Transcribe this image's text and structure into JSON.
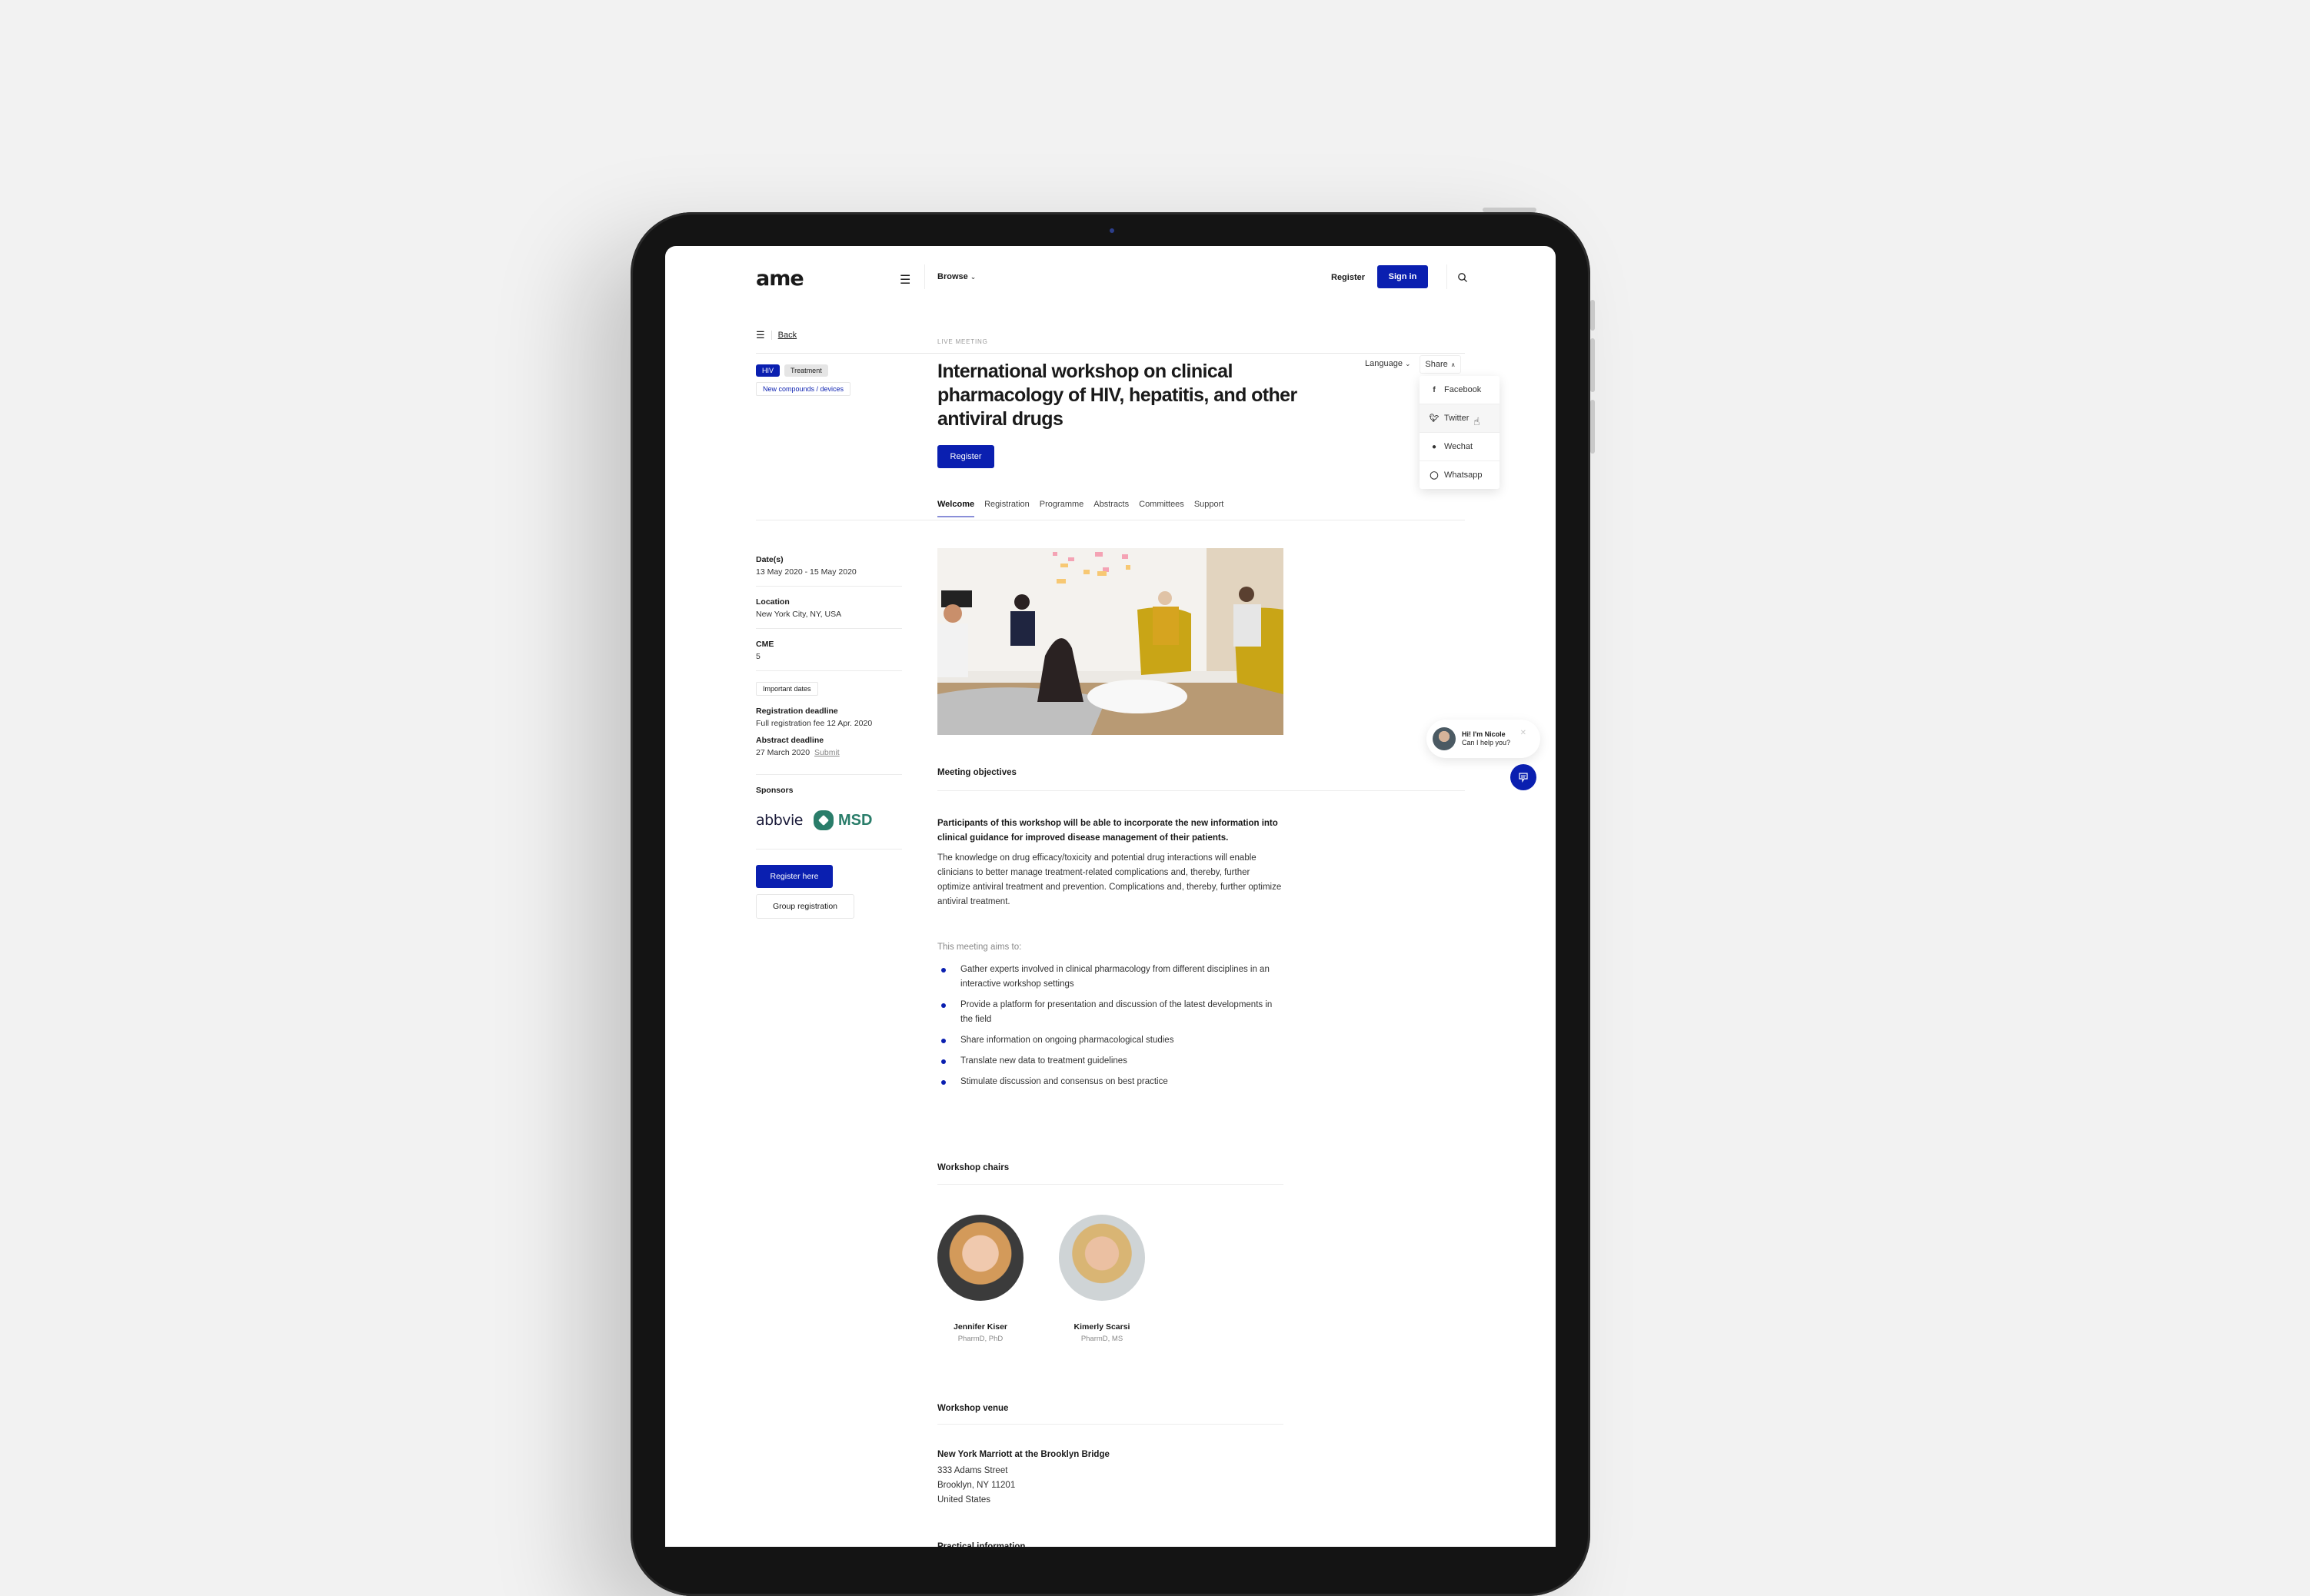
{
  "header": {
    "logo": "ame",
    "browse_label": "Browse",
    "register_label": "Register",
    "signin_label": "Sign in"
  },
  "back_label": "Back",
  "event": {
    "type_label": "LIVE MEETING",
    "title": "International workshop on clinical pharmacology of HIV, hepatitis, and other antiviral drugs",
    "register_label": "Register",
    "tags": [
      "HIV",
      "Treatment",
      "New compounds / devices"
    ]
  },
  "controls": {
    "language_label": "Language",
    "share_label": "Share",
    "share_menu": [
      {
        "label": "Facebook",
        "icon": "facebook-icon"
      },
      {
        "label": "Twitter",
        "icon": "twitter-icon"
      },
      {
        "label": "Wechat",
        "icon": "wechat-icon"
      },
      {
        "label": "Whatsapp",
        "icon": "whatsapp-icon"
      }
    ]
  },
  "tabs": [
    "Welcome",
    "Registration",
    "Programme",
    "Abstracts",
    "Committees",
    "Support"
  ],
  "active_tab": "Welcome",
  "sidebar": {
    "dates_label": "Date(s)",
    "dates_value": "13 May 2020 - 15 May 2020",
    "location_label": "Location",
    "location_value": "New York City, NY, USA",
    "cme_label": "CME",
    "cme_value": "5",
    "important_dates_label": "Important dates",
    "reg_deadline_label": "Registration deadline",
    "reg_deadline_value": "Full registration fee 12 Apr. 2020",
    "abstract_deadline_label": "Abstract deadline",
    "abstract_deadline_value": "27 March 2020",
    "submit_label": "Submit",
    "sponsors_label": "Sponsors",
    "sponsors": [
      "abbvie",
      "MSD"
    ],
    "register_here_label": "Register here",
    "group_registration_label": "Group registration"
  },
  "objectives": {
    "heading": "Meeting objectives",
    "lead": "Participants of this workshop will be able to incorporate the new information into clinical guidance for improved disease management of their patients.",
    "body": "The knowledge on drug efficacy/toxicity and potential drug interactions will enable clinicians to better manage treatment-related complications and, thereby, further optimize antiviral treatment and prevention. Complications and, thereby, further optimize antiviral treatment.",
    "aims_intro": "This meeting aims to:",
    "aims": [
      "Gather experts involved in clinical pharmacology from different disciplines in an interactive workshop settings",
      "Provide a platform for presentation and discussion of the latest developments in the field",
      "Share information on ongoing pharmacological studies",
      "Translate new data to treatment guidelines",
      "Stimulate discussion and consensus on best practice"
    ]
  },
  "chairs": {
    "heading": "Workshop chairs",
    "people": [
      {
        "name": "Jennifer Kiser",
        "degree": "PharmD, PhD"
      },
      {
        "name": "Kimerly Scarsi",
        "degree": "PharmD, MS"
      }
    ]
  },
  "venue": {
    "heading": "Workshop venue",
    "name": "New York Marriott at the Brooklyn Bridge",
    "address": [
      "333 Adams Street",
      "Brooklyn, NY 11201",
      "United States"
    ],
    "next_heading": "Practical information"
  },
  "chat": {
    "greeting": "Hi! I'm Nicole",
    "prompt": "Can I help you?"
  },
  "colors": {
    "accent": "#0a1fb0",
    "msd_green": "#2a7d6a"
  }
}
